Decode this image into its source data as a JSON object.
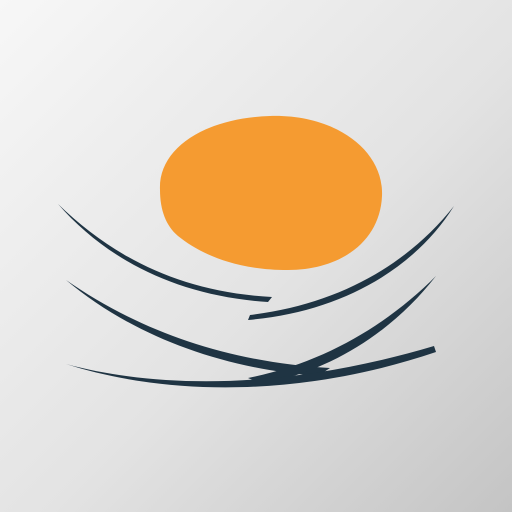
{
  "app_icon": {
    "name": "nest-egg-icon",
    "colors": {
      "background_light": "#f7f7f7",
      "background_dark": "#c4c4c4",
      "egg": "#f59b31",
      "nest": "#1f3443"
    }
  }
}
